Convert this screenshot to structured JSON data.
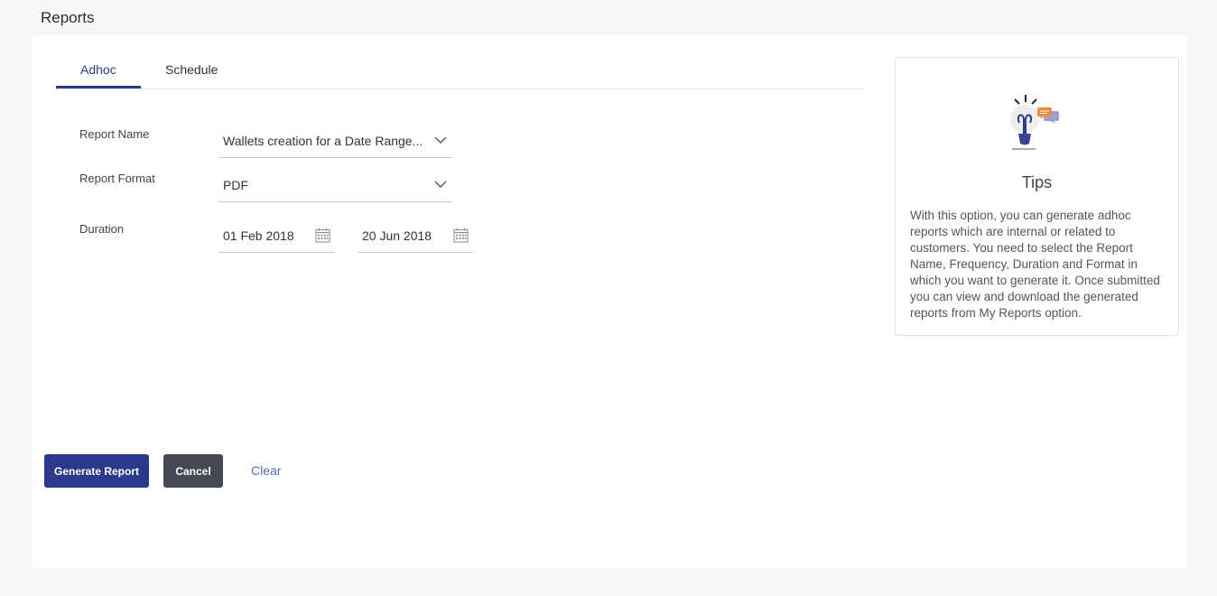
{
  "page": {
    "title": "Reports"
  },
  "tabs": [
    {
      "label": "Adhoc",
      "active": true
    },
    {
      "label": "Schedule",
      "active": false
    }
  ],
  "form": {
    "report_name": {
      "label": "Report Name",
      "value": "Wallets creation for a Date Range..."
    },
    "report_format": {
      "label": "Report Format",
      "value": "PDF"
    },
    "duration": {
      "label": "Duration",
      "from": "01 Feb 2018",
      "to": "20 Jun 2018"
    }
  },
  "actions": {
    "generate": "Generate Report",
    "cancel": "Cancel",
    "clear": "Clear"
  },
  "tips": {
    "title": "Tips",
    "body": "With this option, you can generate adhoc reports which are internal or related to customers. You need to select the Report Name, Frequency, Duration and Format in which you want to generate it. Once submitted you can view and download the generated reports from My Reports option."
  },
  "colors": {
    "primary": "#2b3a8c",
    "cancel": "#454a52",
    "link": "#5a6db0",
    "page_bg": "#f7f7f7"
  },
  "icons": [
    "chevron-down-icon",
    "calendar-icon",
    "lightbulb-icon",
    "chat-bubbles-icon"
  ]
}
